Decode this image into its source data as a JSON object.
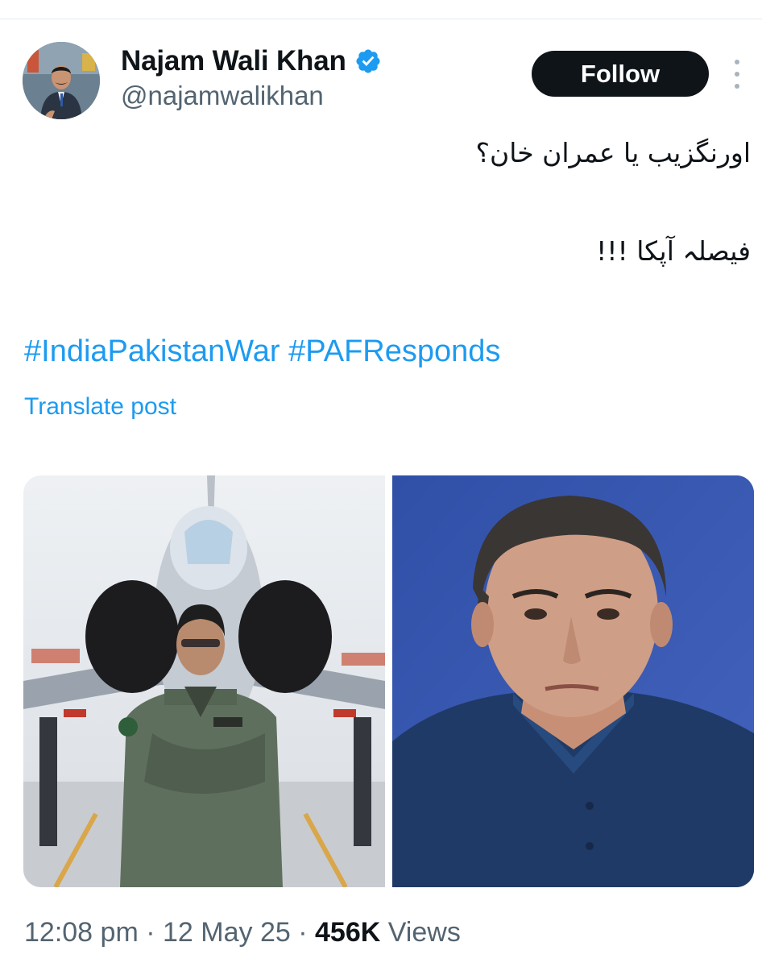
{
  "author": {
    "name": "Najam Wali Khan",
    "handle": "@najamwalikhan",
    "verified": true,
    "verified_icon": "verified-badge-icon",
    "avatar_icon": "avatar"
  },
  "header": {
    "follow_label": "Follow",
    "more_icon": "vertical-dots-icon"
  },
  "post": {
    "text_lines": [
      "اورنگزیب یا عمران خان؟",
      "فیصلہ آپکا !!!"
    ],
    "hashtags": [
      "#IndiaPakistanWar",
      "#PAFResponds"
    ],
    "translate_label": "Translate post"
  },
  "media": [
    {
      "description_icon": "photo-pilot-with-jet"
    },
    {
      "description_icon": "photo-man-portrait-blue-background"
    }
  ],
  "meta": {
    "time": "12:08 pm",
    "separator": "·",
    "date": "12 May 25",
    "views_count": "456K",
    "views_label": "Views"
  },
  "colors": {
    "link": "#1d9bf0",
    "text_primary": "#0f1419",
    "text_secondary": "#536471",
    "follow_bg": "#0f1419",
    "verified": "#1d9bf0"
  }
}
